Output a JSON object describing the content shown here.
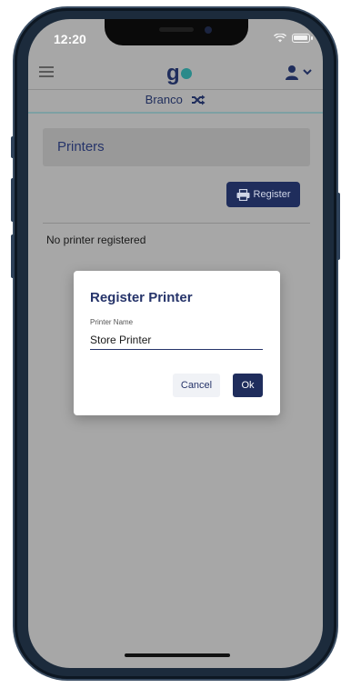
{
  "status_bar": {
    "time": "12:20"
  },
  "app": {
    "logo_text": "g"
  },
  "branch": {
    "name": "Branco"
  },
  "page": {
    "title": "Printers",
    "register_label": "Register",
    "empty_message": "No printer registered"
  },
  "modal": {
    "title": "Register Printer",
    "field_label": "Printer Name",
    "field_value": "Store Printer",
    "cancel_label": "Cancel",
    "ok_label": "Ok"
  },
  "colors": {
    "brand_navy": "#1f2d5c",
    "accent_teal": "#2a8a8a",
    "overlay_gray": "#a7a7a7"
  },
  "icons": [
    "hamburger-icon",
    "user-icon",
    "chevron-down-icon",
    "shuffle-icon",
    "printer-icon",
    "wifi-icon",
    "battery-icon"
  ]
}
